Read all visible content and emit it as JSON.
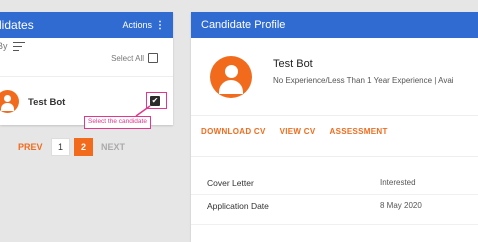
{
  "left": {
    "title": "didates",
    "actions_label": "Actions",
    "kebab": "⋮",
    "sort_label": "By",
    "select_all": "Select All",
    "candidate_name": "Test Bot",
    "callout_text": "Select the candidate",
    "check_glyph": "✔"
  },
  "pagination": {
    "prev": "PREV",
    "page1": "1",
    "page2": "2",
    "next": "NEXT"
  },
  "right": {
    "title": "Candidate Profile",
    "name": "Test Bot",
    "experience": "No Experience/Less Than 1 Year Experience  |  Avai",
    "actions": [
      "DOWNLOAD CV",
      "VIEW CV",
      "ASSESSMENT"
    ],
    "details": [
      {
        "label": "Cover Letter",
        "value": "Interested"
      },
      {
        "label": "Application Date",
        "value": "8 May 2020"
      }
    ]
  },
  "colors": {
    "accent": "#f26b1d",
    "header_blue": "#2f6bd1",
    "annotation_pink": "#e3378f"
  }
}
